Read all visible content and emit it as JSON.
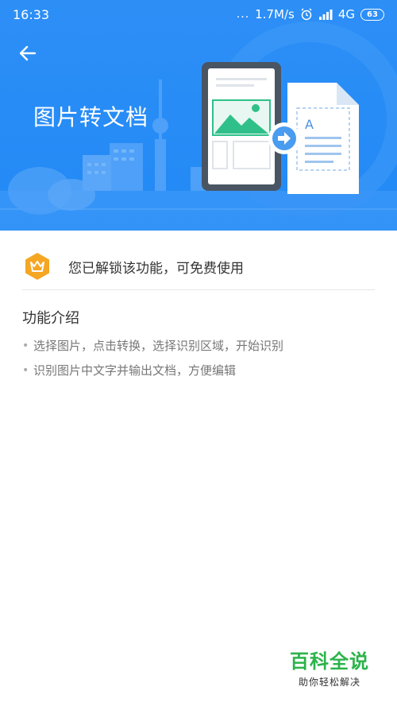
{
  "status_bar": {
    "time": "16:33",
    "dots": "...",
    "net_speed": "1.7M/s",
    "network": "4G",
    "battery": "63",
    "icons": [
      "alarm-icon",
      "hd-signal-icon"
    ]
  },
  "header": {
    "back_icon": "arrow-left-icon",
    "title": "图片转文档",
    "colors": {
      "background": "#2289f5",
      "illustration_green": "#2fc08a",
      "arrow_circle": "#4a9cf0"
    }
  },
  "unlock": {
    "icon": "crown-icon",
    "text": "您已解锁该功能，可免费使用",
    "icon_color": "#f5a623"
  },
  "intro": {
    "title": "功能介绍",
    "items": [
      "选择图片，点击转换，选择识别区域，开始识别",
      "识别图片中文字并输出文档，方便编辑"
    ]
  },
  "watermark": {
    "title": "百科全说",
    "subtitle": "助你轻松解决"
  }
}
